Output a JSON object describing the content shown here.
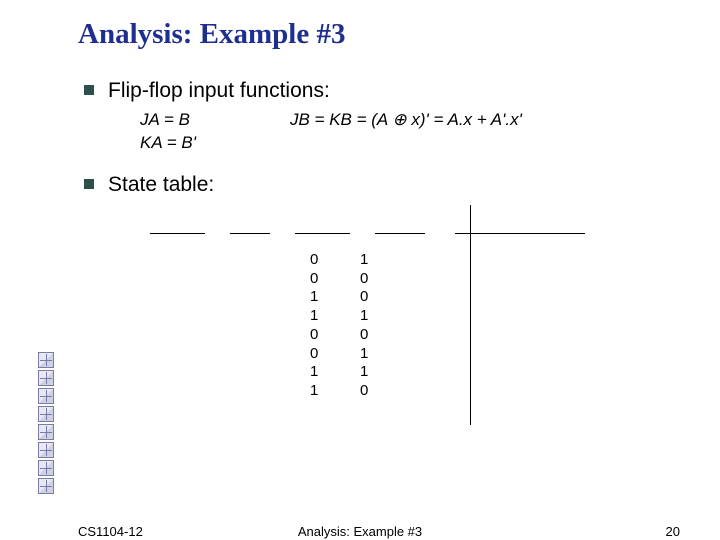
{
  "title": "Analysis: Example #3",
  "bullets": {
    "flipflop": "Flip-flop input functions:",
    "statetable": "State table:"
  },
  "equations": {
    "ja": "JA = B",
    "jb": "JB = KB = (A ⊕ x)' = A.x + A'.x'",
    "ka": "KA = B'"
  },
  "table": {
    "rows": [
      {
        "c0": "0",
        "c1": "1"
      },
      {
        "c0": "0",
        "c1": "0"
      },
      {
        "c0": "1",
        "c1": "0"
      },
      {
        "c0": "1",
        "c1": "1"
      },
      {
        "c0": "0",
        "c1": "0"
      },
      {
        "c0": "0",
        "c1": "1"
      },
      {
        "c0": "1",
        "c1": "1"
      },
      {
        "c0": "1",
        "c1": "0"
      }
    ]
  },
  "footer": {
    "left": "CS1104-12",
    "center": "Analysis: Example #3",
    "right": "20"
  },
  "icons": {
    "box": "placeholder-box-icon"
  }
}
